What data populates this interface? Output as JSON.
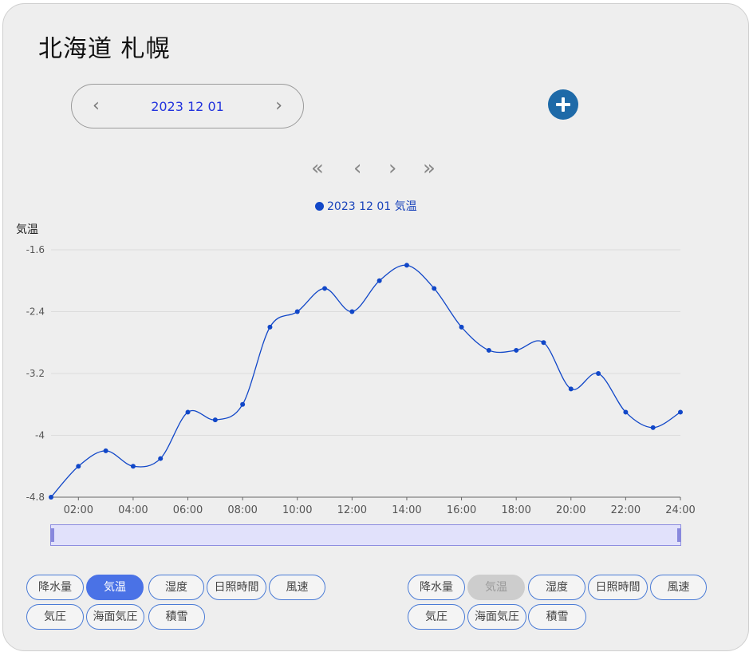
{
  "title": "北海道 札幌",
  "date_picker": {
    "date": "2023 12 01",
    "prev_icon": "‹",
    "next_icon": "›"
  },
  "add_button": {
    "icon": "plus-circle-icon",
    "color": "#1e6aa8"
  },
  "chart_nav": {
    "first": "«",
    "prev": "‹",
    "next": "›",
    "last": "»"
  },
  "legend": {
    "label": "2023 12 01 気温",
    "color": "#1147c8"
  },
  "chart_data": {
    "type": "line",
    "title": "",
    "ylabel": "気温",
    "xlabel": "",
    "ylim": [
      -4.8,
      -1.6
    ],
    "yticks": [
      "-1.6",
      "-2.4",
      "-3.2",
      "-4",
      "-4.8"
    ],
    "xlim": [
      1,
      24
    ],
    "xticks": [
      "02:00",
      "04:00",
      "06:00",
      "08:00",
      "10:00",
      "12:00",
      "14:00",
      "16:00",
      "18:00",
      "20:00",
      "22:00",
      "24:00"
    ],
    "grid": true,
    "series": [
      {
        "name": "2023 12 01 気温",
        "color": "#1147c8",
        "x": [
          1,
          2,
          3,
          4,
          5,
          6,
          7,
          8,
          9,
          10,
          11,
          12,
          13,
          14,
          15,
          16,
          17,
          18,
          19,
          20,
          21,
          22,
          23,
          24
        ],
        "values": [
          -4.8,
          -4.4,
          -4.2,
          -4.4,
          -4.3,
          -3.7,
          -3.8,
          -3.6,
          -2.6,
          -2.4,
          -2.1,
          -2.4,
          -2.0,
          -1.8,
          -2.1,
          -2.6,
          -2.9,
          -2.9,
          -2.8,
          -3.4,
          -3.2,
          -3.7,
          -3.9,
          -3.7
        ]
      }
    ]
  },
  "left_buttons": [
    {
      "label": "降水量",
      "state": "normal"
    },
    {
      "label": "気温",
      "state": "active"
    },
    {
      "label": "湿度",
      "state": "normal"
    },
    {
      "label": "日照時間",
      "state": "normal"
    },
    {
      "label": "風速",
      "state": "normal"
    },
    {
      "label": "気圧",
      "state": "normal"
    },
    {
      "label": "海面気圧",
      "state": "normal"
    },
    {
      "label": "積雪",
      "state": "normal"
    }
  ],
  "right_buttons": [
    {
      "label": "降水量",
      "state": "normal"
    },
    {
      "label": "気温",
      "state": "disabled"
    },
    {
      "label": "湿度",
      "state": "normal"
    },
    {
      "label": "日照時間",
      "state": "normal"
    },
    {
      "label": "風速",
      "state": "normal"
    },
    {
      "label": "気圧",
      "state": "normal"
    },
    {
      "label": "海面気圧",
      "state": "normal"
    },
    {
      "label": "積雪",
      "state": "normal"
    }
  ]
}
